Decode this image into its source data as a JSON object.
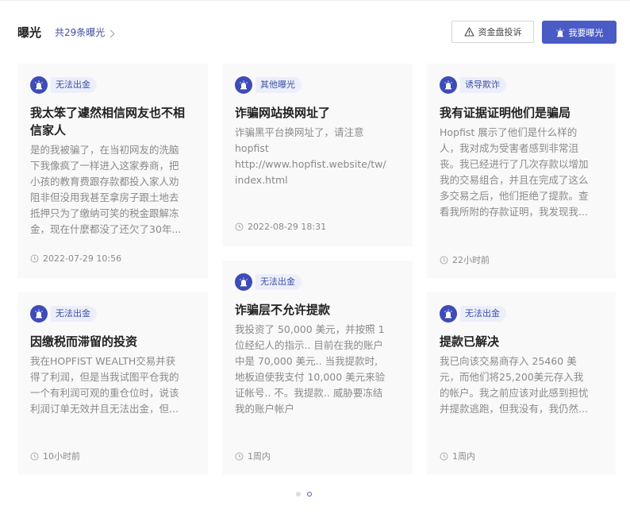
{
  "header": {
    "title": "曝光",
    "count_link": "共29条曝光",
    "complain_button": "资金盘投诉",
    "expose_button": "我要曝光"
  },
  "cards": [
    {
      "tag": "无法出金",
      "title_lines": [
        "我太笨了遽然相信网友也不相",
        "信家人"
      ],
      "body_lines": [
        "是的我被骗了，在当初网友的洗脑",
        "下我像疯了一样进入这家券商，把",
        "小孩的教育费跟存款都投入家人劝",
        "阻非但没用我甚至拿房子跟土地去",
        "抵押只为了缴纳可笑的税金跟解冻",
        "金，现在什麼都没了还欠了30年..."
      ],
      "time": "2022-07-29 10:56"
    },
    {
      "tag": "其他曝光",
      "title_lines": [
        "诈骗网站换网址了"
      ],
      "body_lines": [
        "诈骗黑平台换网址了，请注意",
        "hopfist",
        "http://www.hopfist.website/tw/",
        "index.html"
      ],
      "time": "2022-08-29 18:31"
    },
    {
      "tag": "诱导欺诈",
      "title_lines": [
        "我有证据证明他们是骗局"
      ],
      "body_lines": [
        "Hopfist 展示了他们是什么样的",
        "人，我对成为受害者感到非常沮",
        "丧。我已经进行了几次存款以增加",
        "我的交易组合，并且在完成了这么",
        "多交易之后，他们拒绝了提款。查",
        "看我所附的存款证明，我发现我..."
      ],
      "time": "22小时前"
    },
    {
      "tag": "无法出金",
      "title_lines": [
        "因缴税而滞留的投资"
      ],
      "body_lines": [
        "我在HOPFIST WEALTH交易并获",
        "得了利润，但是当我试图平仓我的",
        "一个有利润可观的重仓位时，说该",
        "利润订单无效并且无法出金，但..."
      ],
      "time": "10小时前"
    },
    {
      "tag": "无法出金",
      "title_lines": [
        "诈骗层不允许提款"
      ],
      "body_lines": [
        "我投资了 50,000 美元，并按照 1",
        "位经纪人的指示.. 目前在我的账户",
        "中是 70,000 美元.. 当我提款时,",
        "地板迫使我支付 10,000 美元来验",
        "证帐号.. 不。我提款.. 威胁要冻结",
        "我的账户帐户"
      ],
      "time": "1周内"
    },
    {
      "tag": "无法出金",
      "title_lines": [
        "提款已解决"
      ],
      "body_lines": [
        "我已向该交易商存入 25460 美",
        "元，而他们将25,200美元存入我",
        "的帐户。我之前应该对此感到担忧",
        "并提款逃跑，但我没有，我仍然..."
      ],
      "time": "1周内"
    }
  ],
  "pagination": {
    "pages": 2,
    "current": 2
  },
  "colors": {
    "accent": "#4a5bc6",
    "tag_bg": "#eceffa",
    "card_bg": "#f9f9fa"
  },
  "icons": {
    "badge": "alarm-icon",
    "time": "clock-icon",
    "complain": "warning-icon",
    "more": "chevron-right-icon"
  }
}
